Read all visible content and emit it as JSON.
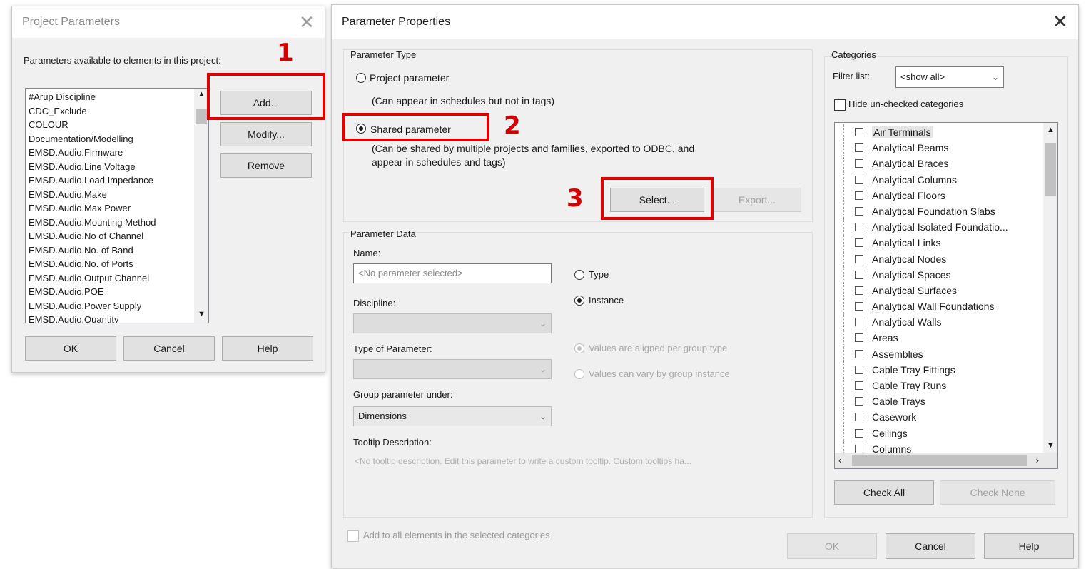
{
  "colors": {
    "annotation_red": "#e00000",
    "dialog_bg": "#f0f0f0",
    "button_bg": "#e1e1e1"
  },
  "project_parameters": {
    "title": "Project Parameters",
    "close_icon": "close-icon",
    "list_label": "Parameters available to elements in this project:",
    "items": [
      "#Arup Discipline",
      "CDC_Exclude",
      "COLOUR",
      "Documentation/Modelling",
      "EMSD.Audio.Firmware",
      "EMSD.Audio.Line Voltage",
      "EMSD.Audio.Load Impedance",
      "EMSD.Audio.Make",
      "EMSD.Audio.Max Power",
      "EMSD.Audio.Mounting Method",
      "EMSD.Audio.No of Channel",
      "EMSD.Audio.No. of Band",
      "EMSD.Audio.No. of Ports",
      "EMSD.Audio.Output Channel",
      "EMSD.Audio.POE",
      "EMSD.Audio.Power Supply",
      "EMSD.Audio.Quantity"
    ],
    "add": "Add...",
    "modify": "Modify...",
    "remove": "Remove",
    "ok": "OK",
    "cancel": "Cancel",
    "help": "Help"
  },
  "annotations": {
    "one": "1",
    "two": "2",
    "three": "3"
  },
  "parameter_properties": {
    "title": "Parameter Properties",
    "close_icon": "close-icon",
    "parameter_type": {
      "heading": "Parameter Type",
      "project_label": "Project parameter",
      "project_note": "(Can appear in schedules but not in tags)",
      "shared_label": "Shared parameter",
      "shared_note_1": "(Can be shared by multiple projects and families, exported to ODBC, and",
      "shared_note_2": "appear in schedules and tags)",
      "selected": "Shared parameter",
      "select_button": "Select...",
      "export_button": "Export..."
    },
    "parameter_data": {
      "heading": "Parameter Data",
      "name_label": "Name:",
      "name_placeholder": "<No parameter selected>",
      "discipline_label": "Discipline:",
      "type_of_parameter_label": "Type of Parameter:",
      "group_label": "Group parameter under:",
      "group_value": "Dimensions",
      "tooltip_label": "Tooltip Description:",
      "tooltip_text": "<No tooltip description. Edit this parameter to write a custom tooltip. Custom tooltips ha...",
      "type_radio": "Type",
      "instance_radio": "Instance",
      "instance_selected": true,
      "aligned_radio": "Values are aligned per group type",
      "vary_radio": "Values can vary by group instance"
    },
    "categories": {
      "heading": "Categories",
      "filter_label": "Filter list:",
      "filter_value": "<show all>",
      "hide_unchecked": "Hide un-checked categories",
      "items": [
        "Air Terminals",
        "Analytical Beams",
        "Analytical Braces",
        "Analytical Columns",
        "Analytical Floors",
        "Analytical Foundation Slabs",
        "Analytical Isolated Foundatio...",
        "Analytical Links",
        "Analytical Nodes",
        "Analytical Spaces",
        "Analytical Surfaces",
        "Analytical Wall Foundations",
        "Analytical Walls",
        "Areas",
        "Assemblies",
        "Cable Tray Fittings",
        "Cable Tray Runs",
        "Cable Trays",
        "Casework",
        "Ceilings",
        "Columns"
      ],
      "check_all": "Check All",
      "check_none": "Check None"
    },
    "add_all": "Add to all elements in the selected categories",
    "ok": "OK",
    "cancel": "Cancel",
    "help": "Help"
  }
}
